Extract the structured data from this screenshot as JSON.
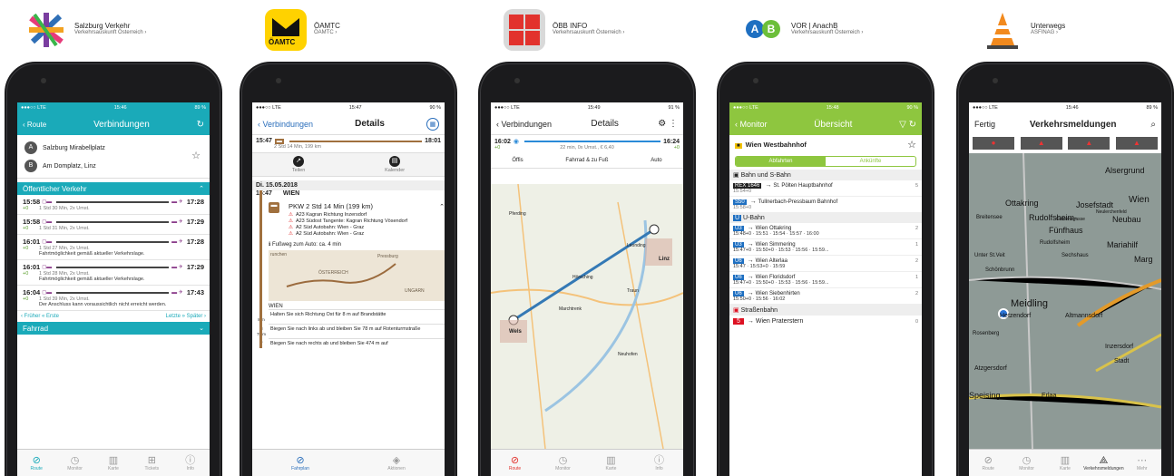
{
  "apps": [
    {
      "name": "Salzburg Verkehr",
      "sub": "Verkehrsauskunft Österreich"
    },
    {
      "name": "ÖAMTC",
      "sub": "ÖAMTC",
      "logo": "ÖAMTC"
    },
    {
      "name": "ÖBB INFO",
      "sub": "Verkehrsauskunft Österreich"
    },
    {
      "name": "VOR | AnachB",
      "sub": "Verkehrsauskunft Österreich",
      "a": "A",
      "b": "B"
    },
    {
      "name": "Unterwegs",
      "sub": "ASFINAG"
    }
  ],
  "s1": {
    "time": "15:46",
    "carrier": "LTE",
    "battery": "89 %",
    "back": "Route",
    "title": "Verbindungen",
    "from": "Salzburg Mirabellplatz",
    "to": "Am Domplatz, Linz",
    "from_badge": "A",
    "to_badge": "B",
    "section": "Öffentlicher Verkehr",
    "rows": [
      {
        "dep": "15:58",
        "delay": "+0",
        "arr": "17:28",
        "info": "1 Std 30 Min, 2x Umst.",
        "note": ""
      },
      {
        "dep": "15:58",
        "delay": "+0",
        "arr": "17:29",
        "info": "1 Std 31 Min, 2x Umst.",
        "note": ""
      },
      {
        "dep": "16:01",
        "delay": "+0",
        "arr": "17:28",
        "info": "1 Std 27 Min, 2x Umst.",
        "note": "Fahrtmöglichkeit gemäß aktueller Verkehrslage."
      },
      {
        "dep": "16:01",
        "delay": "+0",
        "arr": "17:29",
        "info": "1 Std 28 Min, 2x Umst.",
        "note": "Fahrtmöglichkeit gemäß aktueller Verkehrslage."
      },
      {
        "dep": "16:04",
        "delay": "+0",
        "arr": "17:43",
        "info": "1 Std 39 Min, 2x Umst.",
        "note": "Der Anschluss kann voraussichtlich nicht erreicht werden."
      }
    ],
    "earlier": "Früher",
    "first": "Erste",
    "last": "Letzte",
    "later": "Später",
    "bike": "Fahrrad",
    "tabs": [
      "Route",
      "Monitor",
      "Karte",
      "Tickets",
      "Info"
    ]
  },
  "s2": {
    "time": "15:47",
    "carrier": "LTE",
    "battery": "90 %",
    "back": "Verbindungen",
    "title": "Details",
    "dep": "15:47",
    "arr": "18:01",
    "dur": "2 Std 14 Min, 199 km",
    "share": "Teilen",
    "calendar": "Kalender",
    "date": "Di. 15.05.2018",
    "t": "15:47",
    "city": "WIEN",
    "pkw": "PKW 2 Std 14 Min (199 km)",
    "route": [
      "A23 Kagran Richtung Inzersdorf",
      "A23 Südost Tangente: Kagran Richtung Vösendorf",
      "A2 Süd Autobahn: Wien - Graz",
      "A2 Süd Autobahn: Wien - Graz"
    ],
    "walk": "Fußweg zum Auto: ca. 4 min",
    "map1": "Pressburg",
    "map2": "ÖSTERREICH",
    "map3": "UNGARN",
    "map4": "runchen",
    "wien": "WIEN",
    "steps": [
      {
        "t": "Halten Sie sich Richtung Ost für 8 m auf Brandstätte",
        "d": "8 m"
      },
      {
        "t": "Biegen Sie nach links ab und bleiben Sie 78 m auf Rotenturmstraße",
        "d": "78 m"
      },
      {
        "t": "Biegen Sie nach rechts ab und bleiben Sie 474 m auf",
        "d": ""
      }
    ],
    "tabs": [
      "Fahrplan",
      "Aktionen"
    ]
  },
  "s3": {
    "time": "15:49",
    "carrier": "LTE",
    "battery": "91 %",
    "back": "Verbindungen",
    "title": "Details",
    "dep": "16:02",
    "arr": "16:24",
    "d1": "+0",
    "d2": "+0",
    "info": "22 min, 0x Umst., € 6,40",
    "modes": [
      "Öffis",
      "Fahrrad & zu Fuß",
      "Auto"
    ],
    "places": [
      "Pferding",
      "Leonding",
      "Linz",
      "Traun",
      "Marchtrenk",
      "Wels",
      "Neuhofen",
      "Hörsching"
    ],
    "tabs": [
      "Route",
      "Monitor",
      "Karte",
      "Info"
    ]
  },
  "s4": {
    "time": "15:48",
    "carrier": "LTE",
    "battery": "90 %",
    "back": "Monitor",
    "title": "Übersicht",
    "station": "Wien Westbahnhof",
    "seg": [
      "Abfahrten",
      "Ankünfte"
    ],
    "h1": "Bahn und S-Bahn",
    "h2": "U-Bahn",
    "h3": "Straßenbahn",
    "rail": [
      {
        "line": "REX 1646",
        "dest": "St. Pölten Hauptbahnhof",
        "t": "15:54+0",
        "p": "5"
      },
      {
        "line": "S50",
        "dest": "Tullnerbach-Pressbaum Bahnhof",
        "t": "15:58+0",
        "p": ""
      }
    ],
    "ubahn": [
      {
        "line": "U3",
        "dest": "Wien Ottakring",
        "t": "15:48+0 · 15:51 · 15:54 · 15:57 · 16:00",
        "p": "2"
      },
      {
        "line": "U3",
        "dest": "Wien Simmering",
        "t": "15:47+0 · 15:50+0 · 15:53 · 15:56 · 15:59...",
        "p": "1"
      },
      {
        "line": "U6",
        "dest": "Wien Alterlaa",
        "t": "15:47 · 15:53+0 · 15:59",
        "p": "2"
      },
      {
        "line": "U6",
        "dest": "Wien Floridsdorf",
        "t": "15:47+0 · 15:50+0 · 15:53 · 15:56 · 15:59...",
        "p": "1"
      },
      {
        "line": "U6",
        "dest": "Wien Siebenhirten",
        "t": "15:50+0 · 15:56 · 16:02",
        "p": "2"
      }
    ],
    "tram": {
      "line": "5",
      "dest": "Wien Praterstern",
      "p": "0"
    }
  },
  "s5": {
    "time": "15:46",
    "carrier": "LTE",
    "battery": "89 %",
    "left": "Fertig",
    "title": "Verkehrsmeldungen",
    "labels": [
      "Alsergrund",
      "Ottakring",
      "Josefstadt",
      "Wien",
      "Breitensee",
      "Rudolfsheim-",
      "Neubau",
      "Fünfhaus",
      "Mariahilf",
      "Unter St.Veit",
      "Sechshaus",
      "Marg",
      "Schönbrunn",
      "Meidling",
      "Hetzendorf",
      "Altmannsdorf",
      "Rosenberg",
      "Inzersdorf",
      "Stadt",
      "Atzgersdorf",
      "Erlaa",
      "Speising",
      "Gablenzgasse",
      "Neulerchenfeld",
      "Rudolfsheim"
    ],
    "tabs": [
      "Route",
      "Monitor",
      "Karte",
      "Verkehrsmeldungen",
      "Mehr"
    ]
  }
}
